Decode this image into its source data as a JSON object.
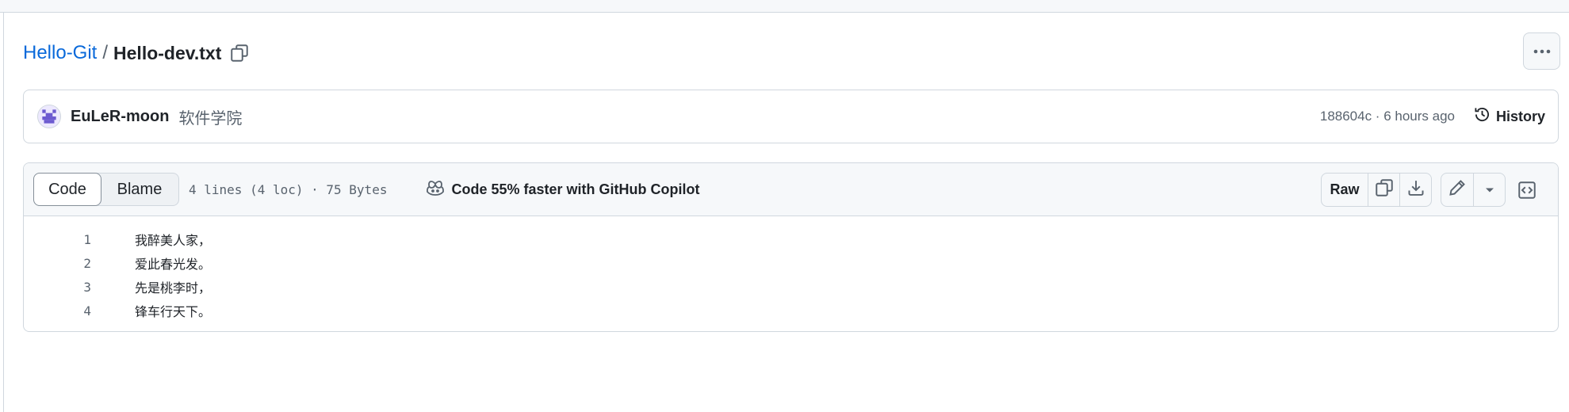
{
  "breadcrumb": {
    "repo": "Hello-Git",
    "separator": "/",
    "file": "Hello-dev.txt"
  },
  "icons": {
    "copy_path": "copy-icon",
    "more": "kebab-horizontal-icon",
    "history": "history-icon",
    "copilot": "copilot-icon",
    "copy_raw": "copy-icon",
    "download": "download-icon",
    "edit": "pencil-icon",
    "dropdown": "triangle-down-icon",
    "symbols": "code-square-icon"
  },
  "commit": {
    "author": "EuLeR-moon",
    "message": "软件学院",
    "meta": "188604c · 6 hours ago",
    "history_label": "History"
  },
  "toolbar": {
    "tab_code": "Code",
    "tab_blame": "Blame",
    "file_info": "4 lines (4 loc) · 75 Bytes",
    "copilot_label": "Code 55% faster with GitHub Copilot",
    "raw_label": "Raw"
  },
  "code_lines": [
    {
      "number": "1",
      "text": "我醉美人家，"
    },
    {
      "number": "2",
      "text": "爱此春光发。"
    },
    {
      "number": "3",
      "text": "先是桃李时，"
    },
    {
      "number": "4",
      "text": "锋车行天下。"
    }
  ],
  "colors": {
    "link": "#0969da",
    "border": "#d0d7de",
    "muted_text": "#59636e",
    "toolbar_bg": "#f6f8fa",
    "avatar_bg": "#ede9fe"
  }
}
